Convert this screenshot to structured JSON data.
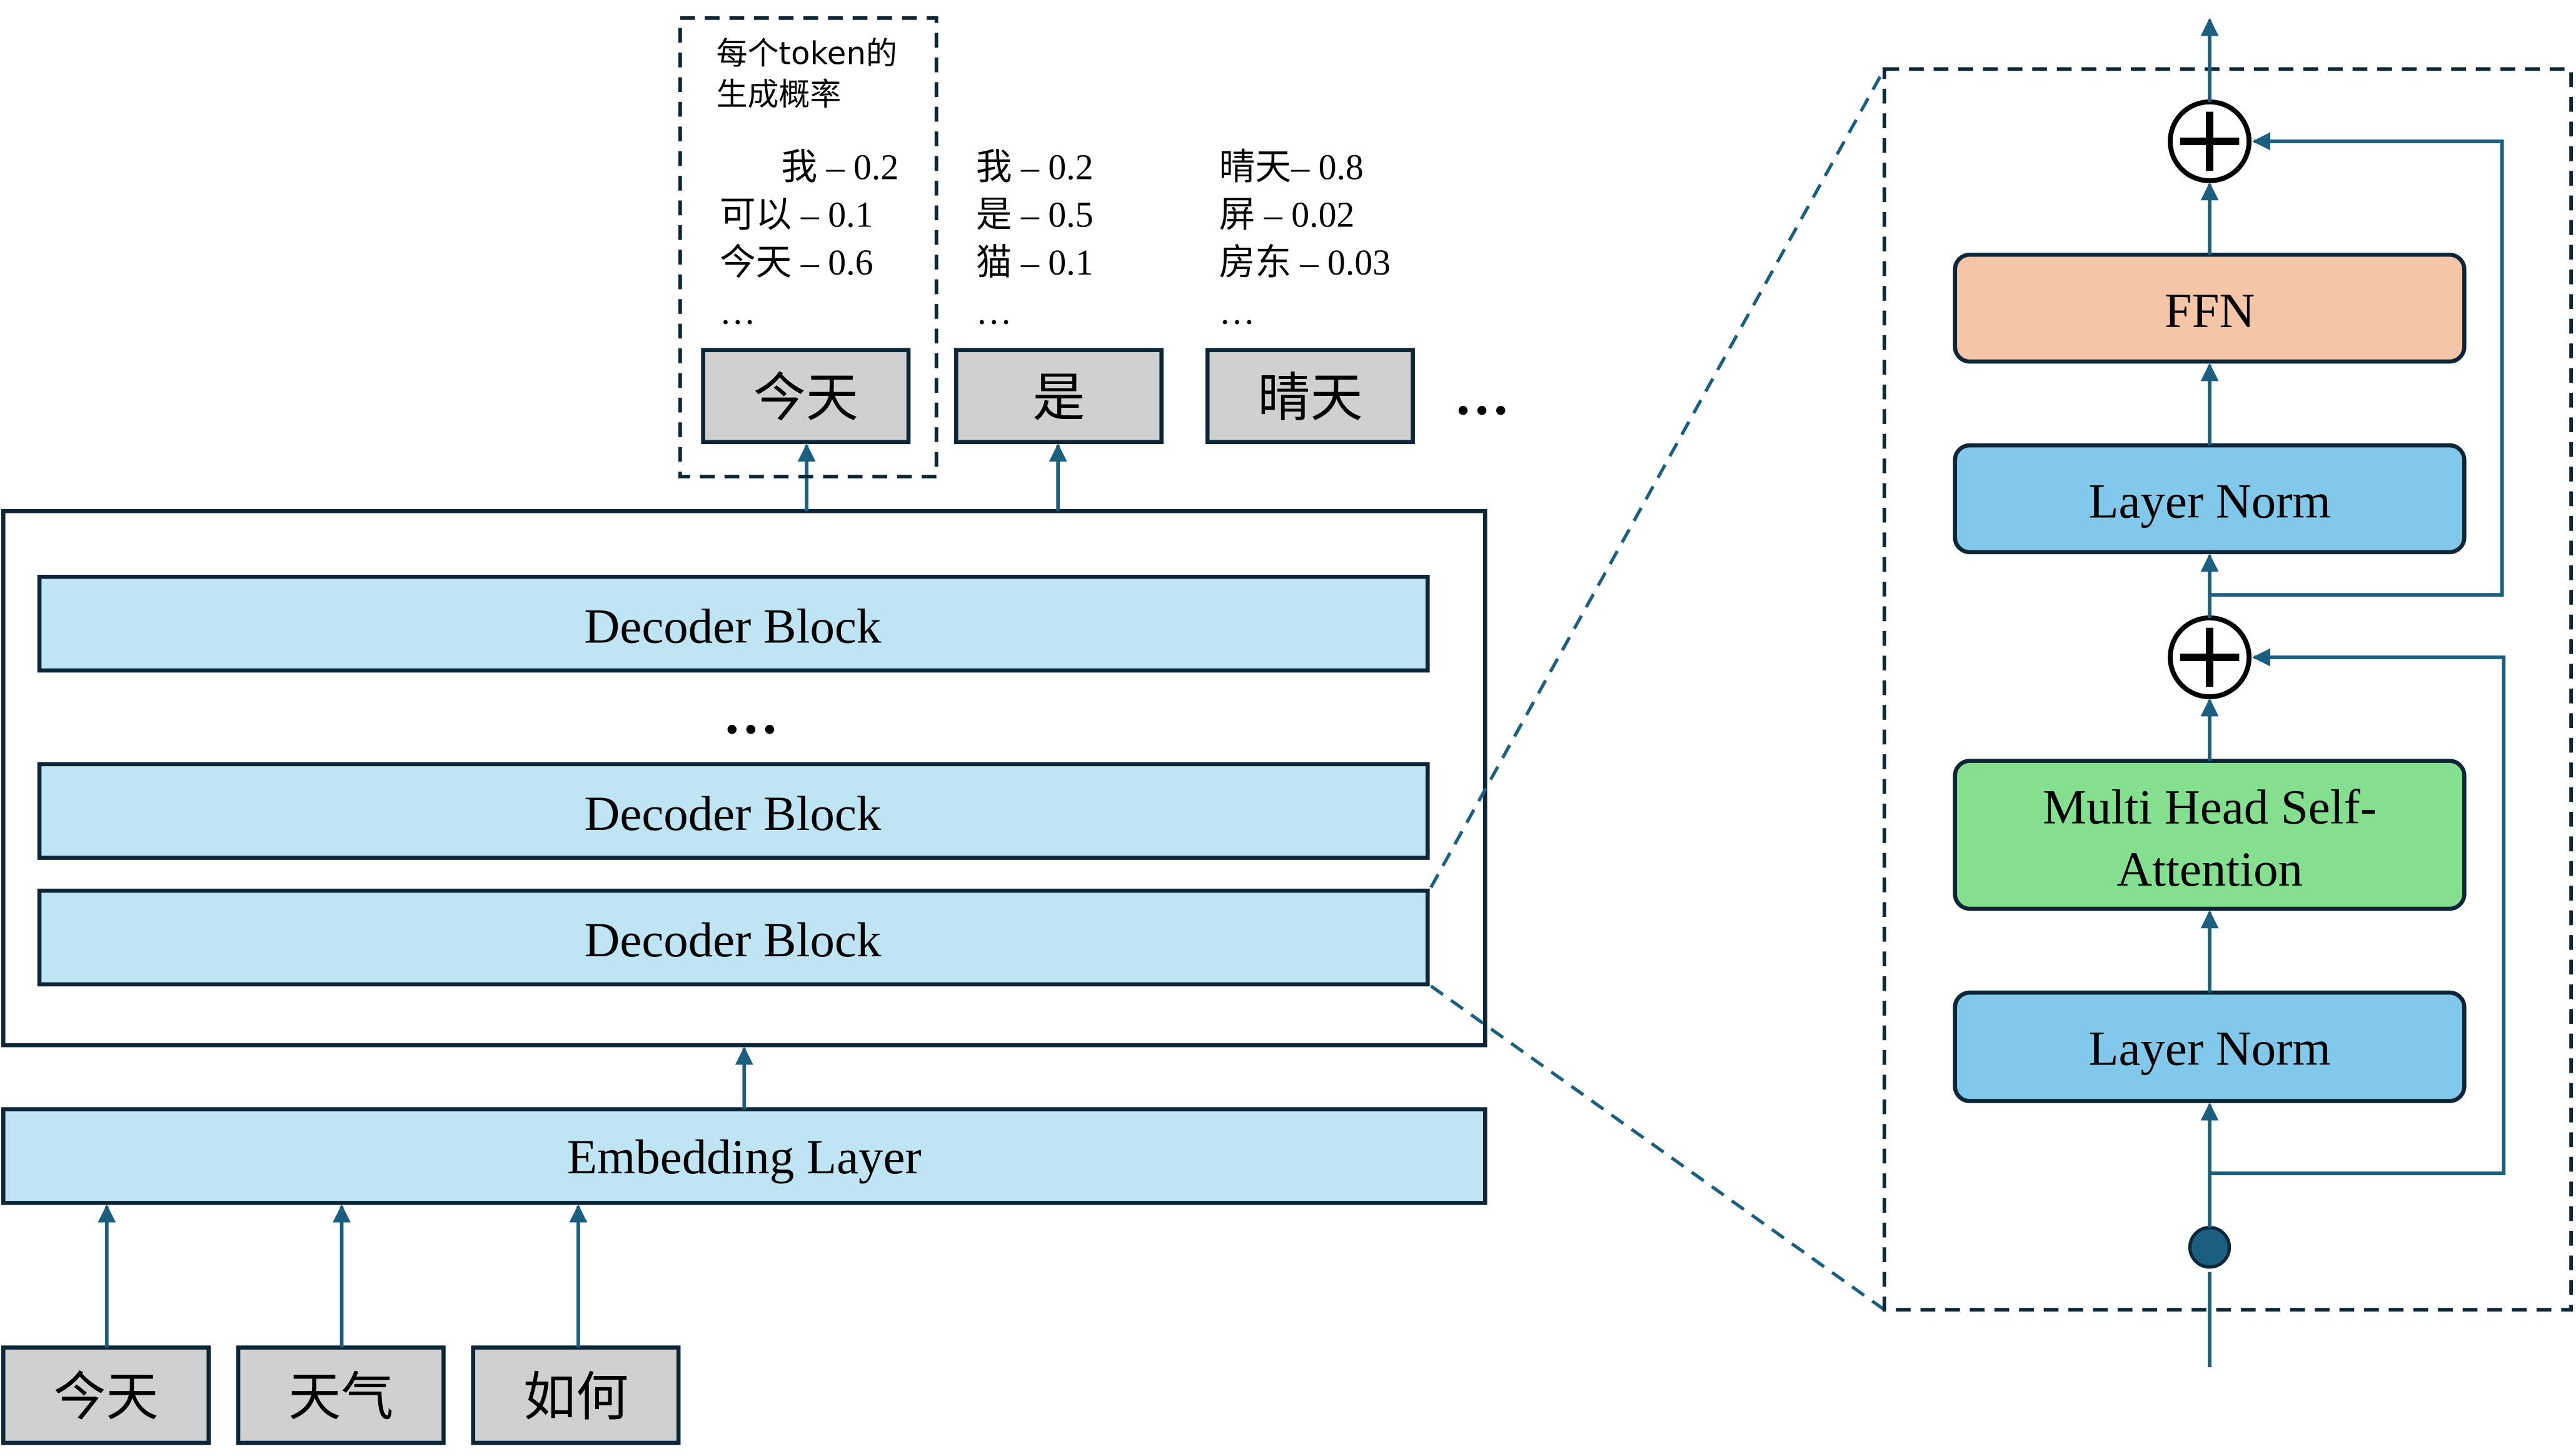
{
  "colors": {
    "outline": "#0d2637",
    "arrow": "#1a5f80",
    "decoder_fill": "#bfe4f4",
    "layer_norm_fill": "#82c8ea",
    "ffn_fill": "#f5c5a8",
    "attention_fill": "#84e08e",
    "token_fill": "#d0d0d0"
  },
  "input_tokens": [
    "今天",
    "天气",
    "如何"
  ],
  "embedding_label": "Embedding Layer",
  "decoder_blocks": [
    "Decoder Block",
    "Decoder Block",
    "Decoder Block"
  ],
  "decoder_ellipsis": "…",
  "output_tokens": [
    "今天",
    "是",
    "晴天"
  ],
  "output_ellipsis": "…",
  "probability_caption": [
    "每个token的",
    "生成概率"
  ],
  "probabilities": [
    [
      "我 – 0.2",
      "可以 – 0.1",
      "今天 – 0.6",
      "…"
    ],
    [
      "我 – 0.2",
      "是 – 0.5",
      "猫 – 0.1",
      "…"
    ],
    [
      "晴天– 0.8",
      "屏 – 0.02",
      "房东 – 0.03",
      "…"
    ]
  ],
  "detail": {
    "ffn": "FFN",
    "layer_norm_top": "Layer Norm",
    "attention": [
      "Multi Head Self-",
      "Attention"
    ],
    "layer_norm_bottom": "Layer Norm",
    "add_symbol": "+"
  }
}
